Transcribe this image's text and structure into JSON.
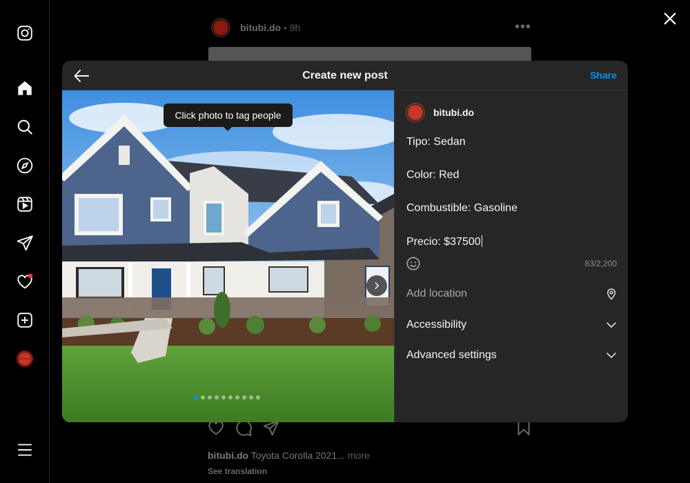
{
  "feed": {
    "username": "bitubi.do",
    "separator": "•",
    "time": "9h",
    "caption_user": "bitubi.do",
    "caption_text": "Toyota Corolla 2021...",
    "caption_more": "more",
    "see_translation": "See translation"
  },
  "modal": {
    "title": "Create new post",
    "share_label": "Share",
    "tooltip": "Click photo to tag people",
    "carousel": {
      "count": 10,
      "active_index": 0
    },
    "author": "bitubi.do",
    "caption_lines": [
      "Tipo: Sedan",
      "Color: Red",
      "Combustible: Gasoline",
      "Precio: $37500"
    ],
    "char_counter": "83/2,200",
    "location_placeholder": "Add location",
    "accessibility_label": "Accessibility",
    "advanced_label": "Advanced settings"
  },
  "colors": {
    "accent": "#0095f6",
    "modal_bg": "#262626",
    "notification_dot": "#ff3040"
  },
  "icons": {
    "rail": [
      "instagram-icon",
      "home-icon",
      "search-icon",
      "explore-icon",
      "reels-icon",
      "messages-icon",
      "notifications-icon",
      "create-icon",
      "profile-avatar",
      "menu-icon"
    ]
  }
}
